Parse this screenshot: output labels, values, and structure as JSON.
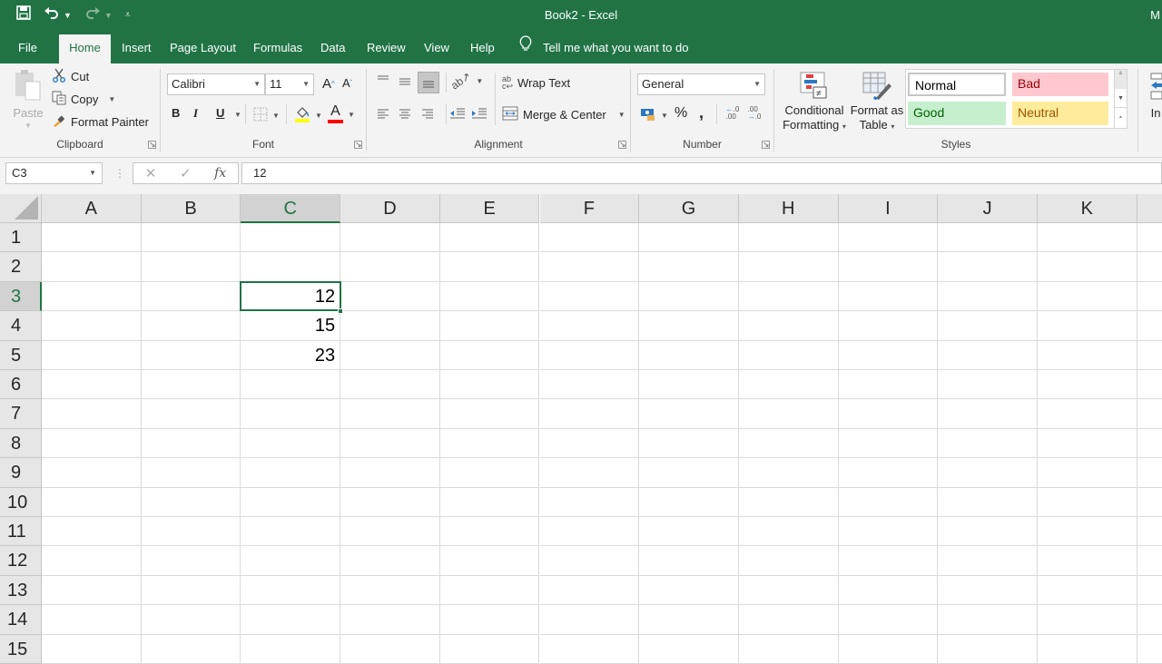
{
  "titlebar": {
    "title": "Book2  -  Excel",
    "user_initial": "M",
    "qat": {
      "save_icon": "save-icon",
      "undo_icon": "undo-icon",
      "redo_icon": "redo-icon",
      "customize_icon": "customize-qat-icon"
    }
  },
  "tabs": [
    {
      "label": "File"
    },
    {
      "label": "Home",
      "active": true
    },
    {
      "label": "Insert"
    },
    {
      "label": "Page Layout"
    },
    {
      "label": "Formulas"
    },
    {
      "label": "Data"
    },
    {
      "label": "Review"
    },
    {
      "label": "View"
    },
    {
      "label": "Help"
    }
  ],
  "tell_me": {
    "label": "Tell me what you want to do",
    "icon": "lightbulb-icon"
  },
  "ribbon": {
    "clipboard": {
      "label": "Clipboard",
      "paste": "Paste",
      "cut": "Cut",
      "copy": "Copy",
      "format_painter": "Format Painter"
    },
    "font": {
      "label": "Font",
      "font_name": "Calibri",
      "font_size": "11",
      "bold": "B",
      "italic": "I",
      "underline": "U",
      "grow": "A",
      "shrink": "A",
      "font_color_letter": "A",
      "fill_color": "#ffff00",
      "font_color": "#ff0000"
    },
    "alignment": {
      "label": "Alignment",
      "wrap_text": "Wrap Text",
      "merge_center": "Merge & Center"
    },
    "number": {
      "label": "Number",
      "format": "General",
      "percent": "%",
      "comma": ",",
      "inc_decimal": "←.0 .00",
      "dec_decimal": ".00 →.0"
    },
    "styles": {
      "label": "Styles",
      "conditional_formatting": [
        "Conditional",
        "Formatting"
      ],
      "format_as_table": [
        "Format as",
        "Table"
      ],
      "gallery": [
        {
          "name": "Normal",
          "bg": "#ffffff",
          "fg": "#000000"
        },
        {
          "name": "Bad",
          "bg": "#ffc7ce",
          "fg": "#9c0006"
        },
        {
          "name": "Good",
          "bg": "#c6efce",
          "fg": "#006100"
        },
        {
          "name": "Neutral",
          "bg": "#ffeb9c",
          "fg": "#9c5700"
        }
      ]
    },
    "cells": {
      "insert_partial": "In"
    }
  },
  "formula_bar": {
    "name_box": "C3",
    "cancel": "✕",
    "enter": "✓",
    "fx": "fx",
    "value": "12"
  },
  "grid": {
    "columns": [
      "A",
      "B",
      "C",
      "D",
      "E",
      "F",
      "G",
      "H",
      "I",
      "J",
      "K"
    ],
    "rows": [
      "1",
      "2",
      "3",
      "4",
      "5",
      "6",
      "7",
      "8",
      "9",
      "10",
      "11",
      "12",
      "13",
      "14",
      "15"
    ],
    "selected_cell": "C3",
    "selected_col": "C",
    "selected_row": "3",
    "cells": [
      {
        "ref": "C3",
        "col": "C",
        "row": "3",
        "value": "12"
      },
      {
        "ref": "C4",
        "col": "C",
        "row": "4",
        "value": "15"
      },
      {
        "ref": "C5",
        "col": "C",
        "row": "5",
        "value": "23"
      }
    ]
  },
  "colors": {
    "accent": "#217346"
  }
}
